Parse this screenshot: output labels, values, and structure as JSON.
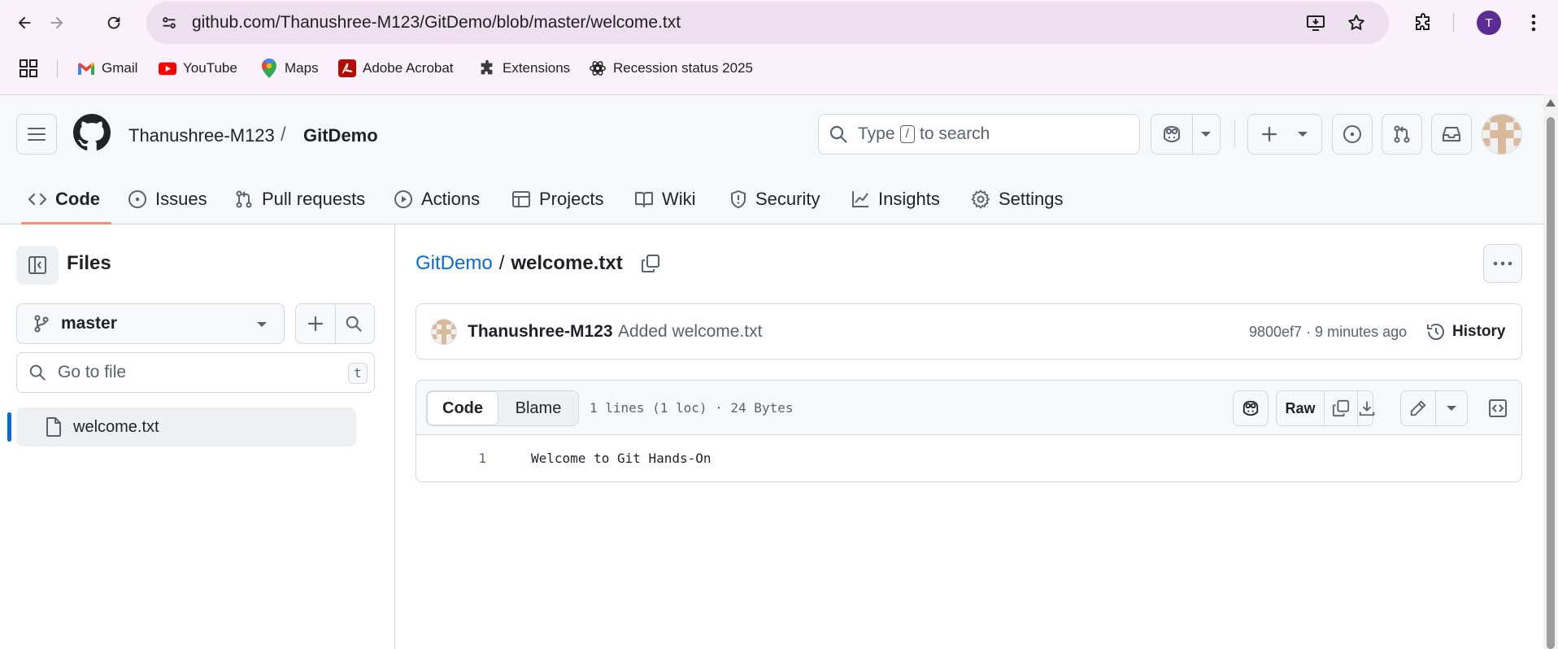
{
  "browser": {
    "url": "github.com/Thanushree-M123/GitDemo/blob/master/welcome.txt",
    "profile_initial": "T",
    "bookmarks": [
      {
        "label": "Gmail",
        "icon": "gmail-icon"
      },
      {
        "label": "YouTube",
        "icon": "youtube-icon"
      },
      {
        "label": "Maps",
        "icon": "maps-icon"
      },
      {
        "label": "Adobe Acrobat",
        "icon": "acrobat-icon"
      },
      {
        "label": "Extensions",
        "icon": "puzzle-icon"
      },
      {
        "label": "Recession status 2025",
        "icon": "openai-icon"
      }
    ]
  },
  "header": {
    "owner": "Thanushree-M123",
    "separator": "/",
    "repo": "GitDemo",
    "search_prefix": "Type",
    "search_key": "/",
    "search_suffix": "to search"
  },
  "repo_nav": {
    "tabs": [
      {
        "label": "Code",
        "icon": "code-icon",
        "active": true
      },
      {
        "label": "Issues",
        "icon": "issue-opened-icon",
        "active": false
      },
      {
        "label": "Pull requests",
        "icon": "git-pull-request-icon",
        "active": false
      },
      {
        "label": "Actions",
        "icon": "play-icon",
        "active": false
      },
      {
        "label": "Projects",
        "icon": "table-icon",
        "active": false
      },
      {
        "label": "Wiki",
        "icon": "book-icon",
        "active": false
      },
      {
        "label": "Security",
        "icon": "shield-icon",
        "active": false
      },
      {
        "label": "Insights",
        "icon": "graph-icon",
        "active": false
      },
      {
        "label": "Settings",
        "icon": "gear-icon",
        "active": false
      }
    ]
  },
  "sidebar": {
    "title": "Files",
    "branch": "master",
    "goto_placeholder": "Go to file",
    "goto_shortcut": "t",
    "files": [
      {
        "name": "welcome.txt",
        "selected": true
      }
    ]
  },
  "main": {
    "breadcrumb_repo": "GitDemo",
    "breadcrumb_sep": "/",
    "breadcrumb_file": "welcome.txt",
    "commit": {
      "author": "Thanushree-M123",
      "message": "Added welcome.txt",
      "meta": "9800ef7 · 9 minutes ago",
      "history_label": "History"
    },
    "file": {
      "view_code": "Code",
      "view_blame": "Blame",
      "stats": "1 lines (1 loc) · 24 Bytes",
      "raw_label": "Raw",
      "lines": [
        {
          "num": "1",
          "text": "Welcome to Git Hands-On"
        }
      ]
    }
  },
  "colors": {
    "link": "#0969da",
    "active_tab_underline": "#fd8c73",
    "browser_bg": "#fbf1fb",
    "profile": "#5b2c91"
  }
}
